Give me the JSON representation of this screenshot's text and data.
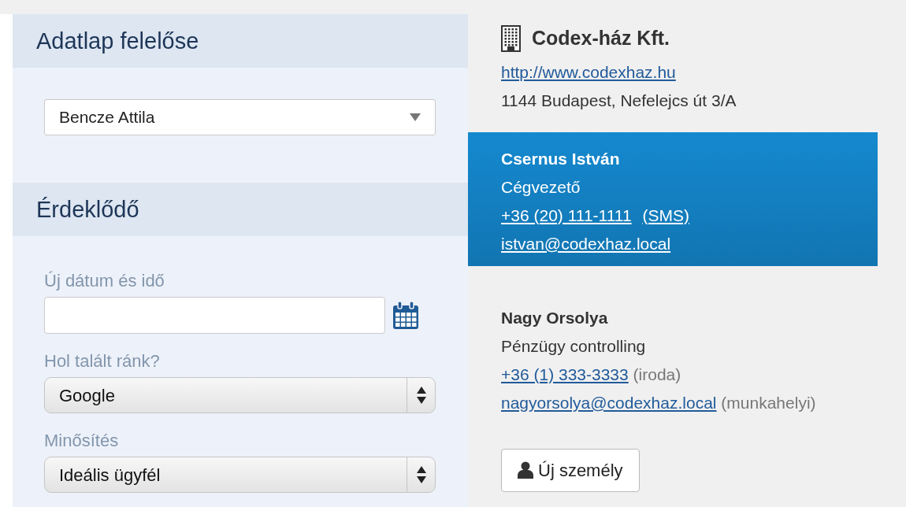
{
  "sections": [
    {
      "title": "Adatlap felelőse",
      "fields": [
        {
          "kind": "dropdown",
          "value": "Bencze Attila"
        }
      ]
    },
    {
      "title": "Érdeklődő",
      "fields": [
        {
          "kind": "date",
          "label": "Új dátum és idő"
        },
        {
          "kind": "select",
          "label": "Hol talált ránk?",
          "value": "Google"
        },
        {
          "kind": "select",
          "label": "Minősítés",
          "value": "Ideális ügyfél"
        }
      ]
    }
  ],
  "company": {
    "name": "Codex-ház Kft.",
    "website": "http://www.codexhaz.hu",
    "address": "1144 Budapest, Nefelejcs út 3/A"
  },
  "contacts": [
    {
      "name": "Csernus István",
      "role": "Cégvezető",
      "phone": "+36 (20) 111-1111",
      "phone_note": "(SMS)",
      "email": "istvan@codexhaz.local",
      "selected": true
    },
    {
      "name": "Nagy Orsolya",
      "role": "Pénzügy controlling",
      "phone": "+36 (1) 333-3333",
      "phone_note": "(iroda)",
      "email": "nagyorsolya@codexhaz.local",
      "email_note": "(munkahelyi)",
      "selected": false
    }
  ],
  "new_person_button": "Új személy"
}
